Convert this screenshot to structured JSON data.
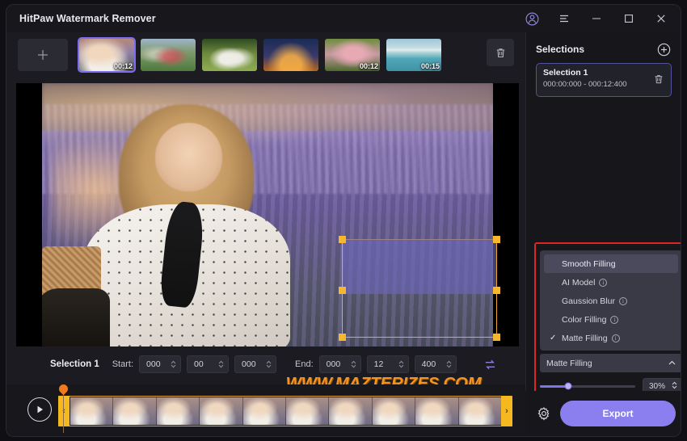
{
  "window": {
    "title": "HitPaw Watermark Remover",
    "controls": [
      {
        "name": "account-icon",
        "glyph": "account"
      },
      {
        "name": "menu-icon",
        "glyph": "menu"
      },
      {
        "name": "minimize-button",
        "glyph": "minimize"
      },
      {
        "name": "maximize-button",
        "glyph": "maximize"
      },
      {
        "name": "close-button",
        "glyph": "close"
      }
    ]
  },
  "thumbstrip": {
    "add_label": "+",
    "delete_icon": "trash-icon",
    "thumbnails": [
      {
        "badge": "00:12",
        "selected": true,
        "scene": "woman-lavender"
      },
      {
        "badge": "",
        "selected": false,
        "scene": "family-field"
      },
      {
        "badge": "",
        "selected": false,
        "scene": "garden-geese"
      },
      {
        "badge": "",
        "selected": false,
        "scene": "city-night"
      },
      {
        "badge": "00:12",
        "selected": false,
        "scene": "pink-flowers"
      },
      {
        "badge": "00:15",
        "selected": false,
        "scene": "beach-city"
      }
    ]
  },
  "preview": {
    "watermark_text": "WWW.MAZTERIZES.COM",
    "selection_box": {
      "label": "selection-rectangle",
      "fill_mode": "Matte Filling"
    }
  },
  "timerow": {
    "selection_label": "Selection 1",
    "start_label": "Start:",
    "start_values": [
      "000",
      "00",
      "000"
    ],
    "end_label": "End:",
    "end_values": [
      "000",
      "12",
      "400"
    ],
    "swap_icon": "sync-icon"
  },
  "timeline": {
    "play_icon": "play-icon",
    "trim_left": "‹",
    "trim_right": "›"
  },
  "selections_panel": {
    "title": "Selections",
    "add_icon": "plus-circle-icon",
    "items": [
      {
        "name": "Selection 1",
        "range": "000:00:000 - 000:12:400",
        "delete_icon": "trash-icon"
      }
    ]
  },
  "fill_panel": {
    "options": [
      {
        "label": "Smooth Filling",
        "checked": false,
        "info": false,
        "highlighted": true
      },
      {
        "label": "AI Model",
        "checked": false,
        "info": true,
        "highlighted": false
      },
      {
        "label": "Gaussion Blur",
        "checked": false,
        "info": true,
        "highlighted": false
      },
      {
        "label": "Color Filling",
        "checked": false,
        "info": true,
        "highlighted": false
      },
      {
        "label": "Matte Filling",
        "checked": true,
        "info": true,
        "highlighted": false
      }
    ],
    "combo_value": "Matte Filling",
    "combo_chevron": "˄",
    "slider_percent_label": "30%",
    "slider_percent": 30,
    "accent_color": "#7e74e8",
    "highlight_color": "#e02424"
  },
  "bottombar": {
    "settings_icon": "gear-icon",
    "export_label": "Export",
    "export_color": "#8b7ff0"
  }
}
